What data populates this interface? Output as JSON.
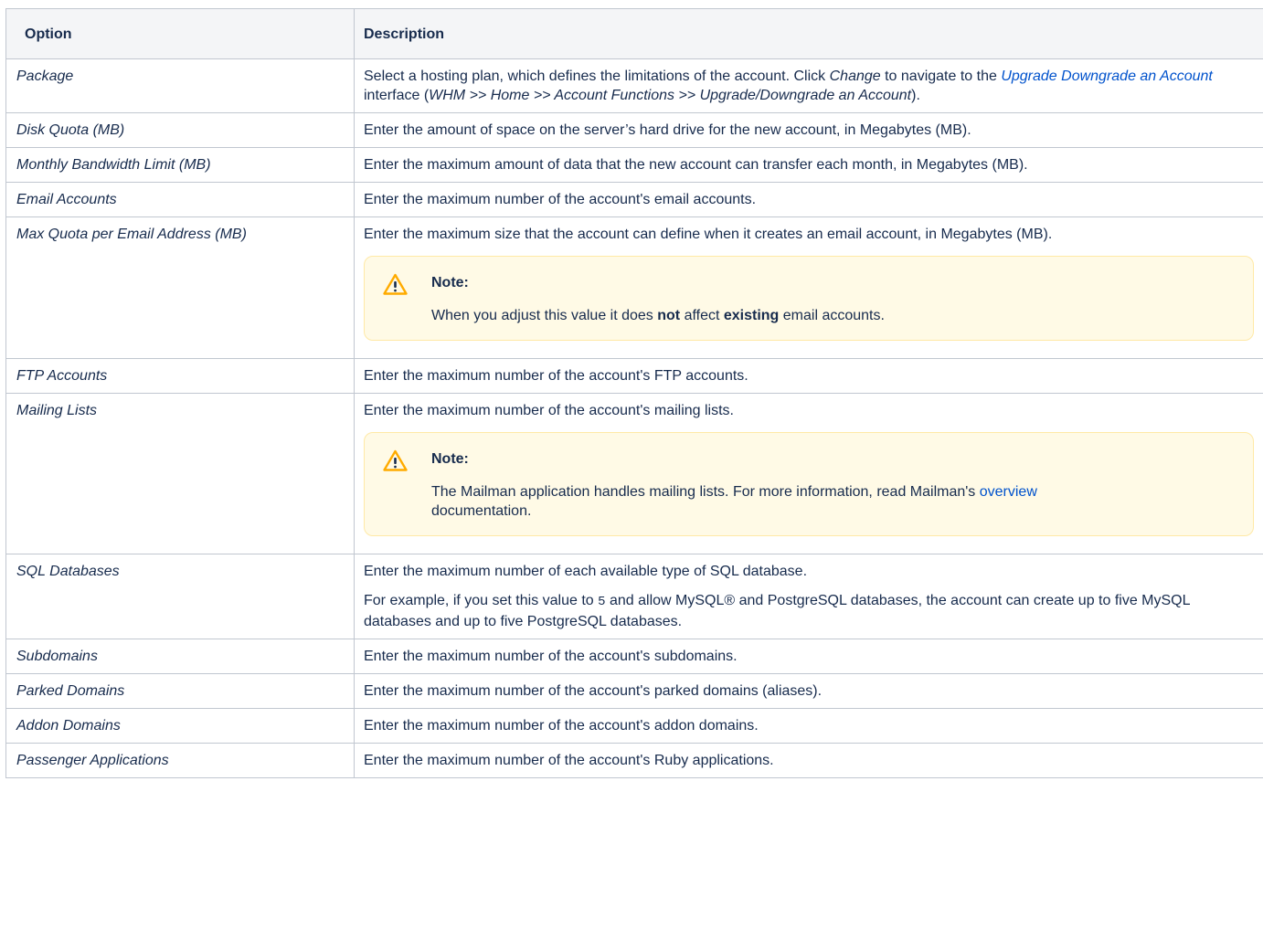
{
  "table": {
    "headers": {
      "option": "Option",
      "description": "Description"
    },
    "rows": [
      {
        "option": "Package",
        "desc": {
          "t1": "Select a hosting plan, which defines the limitations of the account. Click ",
          "change": "Change",
          "t2": " to navigate to the ",
          "link": "Upgrade Downgrade an Account",
          "t3": " interface (",
          "path": "WHM >> Home >> Account Functions >> Upgrade/Downgrade an Account",
          "t4": ")."
        }
      },
      {
        "option": "Disk Quota (MB)",
        "desc": "Enter the amount of space on the server’s hard drive for the new account, in Megabytes (MB)."
      },
      {
        "option": "Monthly Bandwidth Limit (MB)",
        "desc": "Enter the maximum amount of data that the new account can transfer each month, in Megabytes (MB)."
      },
      {
        "option": "Email Accounts",
        "desc": "Enter the maximum number of the account's email accounts."
      },
      {
        "option": "Max Quota per Email Address (MB)",
        "desc": "Enter the maximum size that the account can define when it creates an email account, in Megabytes (MB).",
        "note": {
          "title": "Note:",
          "t1": "When you adjust this value it does ",
          "b1": "not",
          "t2": " affect ",
          "b2": "existing",
          "t3": " email accounts."
        }
      },
      {
        "option": "FTP Accounts",
        "desc": "Enter the maximum number of the account's FTP accounts."
      },
      {
        "option": "Mailing Lists",
        "desc": "Enter the maximum number of the account's mailing lists.",
        "note": {
          "title": "Note:",
          "t1": "The Mailman application handles mailing lists. For more information, read Mailman's ",
          "link": "overview",
          "t2": " documentation."
        }
      },
      {
        "option": "SQL Databases",
        "desc": "Enter the maximum number of each available type of SQL database.",
        "example": {
          "t1": "For example, if you set this value to ",
          "code": "5",
          "t2": " and allow MySQL® and PostgreSQL databases, the account can create up to five MySQL databases and up to five PostgreSQL databases."
        }
      },
      {
        "option": "Subdomains",
        "desc": "Enter the maximum number of the account's subdomains."
      },
      {
        "option": "Parked Domains",
        "desc": "Enter the maximum number of the account's parked domains (aliases)."
      },
      {
        "option": "Addon Domains",
        "desc": "Enter the maximum number of the account's addon domains."
      },
      {
        "option": "Passenger Applications",
        "desc": "Enter the maximum number of the account's Ruby applications."
      }
    ]
  },
  "colors": {
    "link": "#0052cc",
    "note_bg": "#fffae6",
    "note_border": "#ffe9a6",
    "warning_icon": "#ffab00",
    "header_bg": "#f4f5f7",
    "border": "#c1c7d0"
  },
  "icons": {
    "note": "warning-icon"
  }
}
